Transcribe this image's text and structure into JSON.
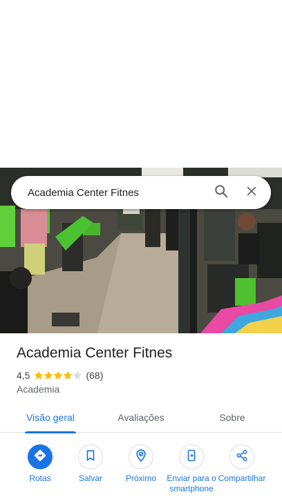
{
  "search": {
    "query": "Academia Center Fitnes",
    "search_icon": "search-icon",
    "close_icon": "close-icon"
  },
  "place": {
    "name": "Academia Center Fitnes",
    "rating": "4,5",
    "rating_value": 4.5,
    "reviews_count": "(68)",
    "category": "Academia"
  },
  "tabs": [
    {
      "label": "Visão geral",
      "active": true
    },
    {
      "label": "Avaliações",
      "active": false
    },
    {
      "label": "Sobre",
      "active": false
    }
  ],
  "actions": [
    {
      "label": "Rotas",
      "icon": "directions-icon"
    },
    {
      "label": "Salvar",
      "icon": "bookmark-icon"
    },
    {
      "label": "Próximo",
      "icon": "nearby-icon"
    },
    {
      "label": "Enviar para o smartphone",
      "icon": "send-to-phone-icon"
    },
    {
      "label": "Compartilhar",
      "icon": "share-icon"
    }
  ],
  "colors": {
    "accent": "#1a73e8",
    "star": "#fbbc04",
    "text": "#202124",
    "muted": "#5f6368"
  }
}
